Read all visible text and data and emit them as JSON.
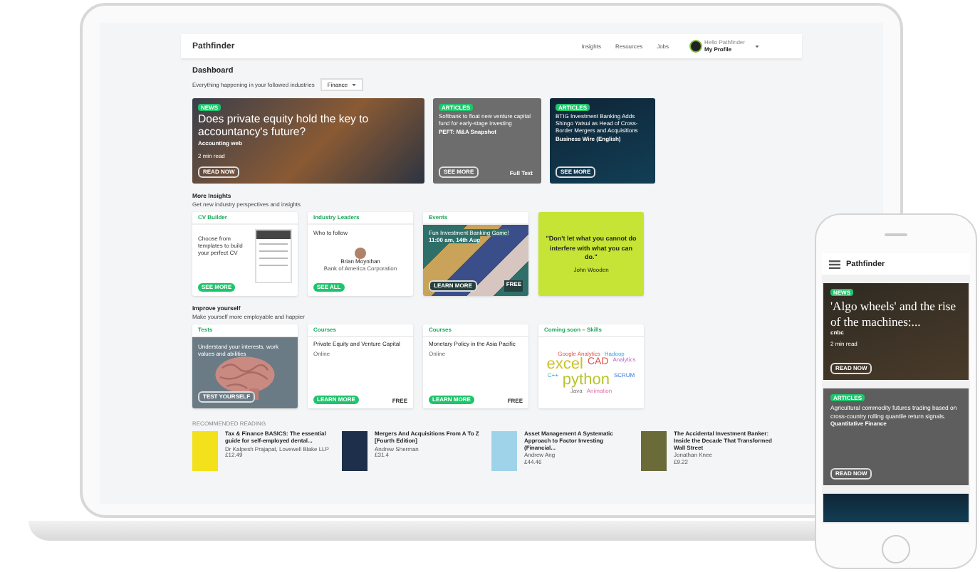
{
  "laptop": {
    "header": {
      "logo": "Pathfinder",
      "nav": [
        "Insights",
        "Resources",
        "Jobs"
      ],
      "profile": {
        "greeting": "Hello Pathfinder",
        "label": "My Profile"
      }
    },
    "dashboard": {
      "title": "Dashboard",
      "subtitle": "Everything happening in your followed industries",
      "filter": "Finance"
    },
    "hero_cards": [
      {
        "tag": "NEWS",
        "title": "Does private equity hold the key to accountancy's future?",
        "source": "Accounting web",
        "meta": "2 min read",
        "button": "READ NOW",
        "kind": "large"
      },
      {
        "tag": "ARTICLES",
        "title": "Softbank to float new venture capital fund for early-stage investing",
        "source": "PEFT: M&A Snapshot",
        "button": "SEE MORE",
        "extra": "Full Text",
        "kind": "paper"
      },
      {
        "tag": "ARTICLES",
        "title": "BTIG Investment Banking Adds Shingo Yatsui as Head of Cross-Border Mergers and Acquisitions",
        "source": "Business Wire (English)",
        "button": "SEE MORE",
        "kind": "network"
      }
    ],
    "insights": {
      "title": "More Insights",
      "subtitle": "Get new industry perspectives and insights",
      "cards": [
        {
          "kind": "cv",
          "label": "CV Builder",
          "text": "Choose from templates to build your perfect CV",
          "button": "SEE MORE"
        },
        {
          "kind": "people",
          "label": "Industry Leaders",
          "text": "Who to follow",
          "name": "Brian Moynihan",
          "org": "Bank of America Corporation",
          "button": "SEE ALL"
        },
        {
          "kind": "event",
          "label": "Events",
          "text": "Fun Investment Banking Game!",
          "time": "11:00 am, 14th Aug",
          "button": "LEARN MORE",
          "price": "FREE"
        },
        {
          "kind": "quote",
          "text": "\"Don't let what you cannot do interfere with what you can do.\"",
          "author": "John Wooden"
        }
      ]
    },
    "improve": {
      "title": "Improve yourself",
      "subtitle": "Make yourself more employable and happier",
      "cards": [
        {
          "kind": "test",
          "label": "Tests",
          "text": "Understand your interests, work values and abilities",
          "button": "TEST YOURSELF"
        },
        {
          "kind": "course",
          "label": "Courses",
          "text": "Private Equity and Venture Capital",
          "mode": "Online",
          "button": "LEARN MORE",
          "price": "FREE"
        },
        {
          "kind": "course",
          "label": "Courses",
          "text": "Monetary Policy in the Asia Pacific",
          "mode": "Online",
          "button": "LEARN MORE",
          "price": "FREE"
        },
        {
          "kind": "skills",
          "label": "Coming soon – Skills",
          "words": [
            {
              "text": "Google Analytics",
              "kind": "small"
            },
            {
              "text": "Hadoop",
              "kind": "small"
            },
            {
              "text": "excel",
              "kind": "large"
            },
            {
              "text": "CAD",
              "kind": "medium"
            },
            {
              "text": "Analytics",
              "kind": "small"
            },
            {
              "text": "C++",
              "kind": "small"
            },
            {
              "text": "python",
              "kind": "large"
            },
            {
              "text": "SCRUM",
              "kind": "small"
            },
            {
              "text": "Java",
              "kind": "small"
            },
            {
              "text": "Animation",
              "kind": "small"
            }
          ]
        }
      ]
    },
    "reading": {
      "title": "RECOMMENDED READING",
      "books": [
        {
          "title": "Tax & Finance BASICS: The essential guide for self-employed dental...",
          "author": "Dr Kalpesh Prajapat, Lovewell Blake LLP",
          "price": "£12.49"
        },
        {
          "title": "Mergers And Acquisitions From A To Z [Fourth Edition]",
          "author": "Andrew Sherman",
          "price": "£31.4"
        },
        {
          "title": "Asset Management A Systematic Approach to Factor Investing (Financial...",
          "author": "Andrew Ang",
          "price": "£44.46"
        },
        {
          "title": "The Accidental Investment Banker: Inside the Decade That Transformed Wall Street",
          "author": "Jonathan Knee",
          "price": "£9.22"
        }
      ]
    }
  },
  "phone": {
    "logo": "Pathfinder",
    "cards": [
      {
        "tag": "NEWS",
        "title": "'Algo wheels' and the rise of the machines:...",
        "source": "cnbc",
        "meta": "2 min read",
        "button": "READ NOW",
        "kind": "photo"
      },
      {
        "tag": "ARTICLES",
        "title": "Agricultural commodity futures trading based on cross-country rolling quantile return signals.",
        "source": "Quantitative Finance",
        "button": "READ NOW",
        "kind": "paper"
      }
    ]
  }
}
